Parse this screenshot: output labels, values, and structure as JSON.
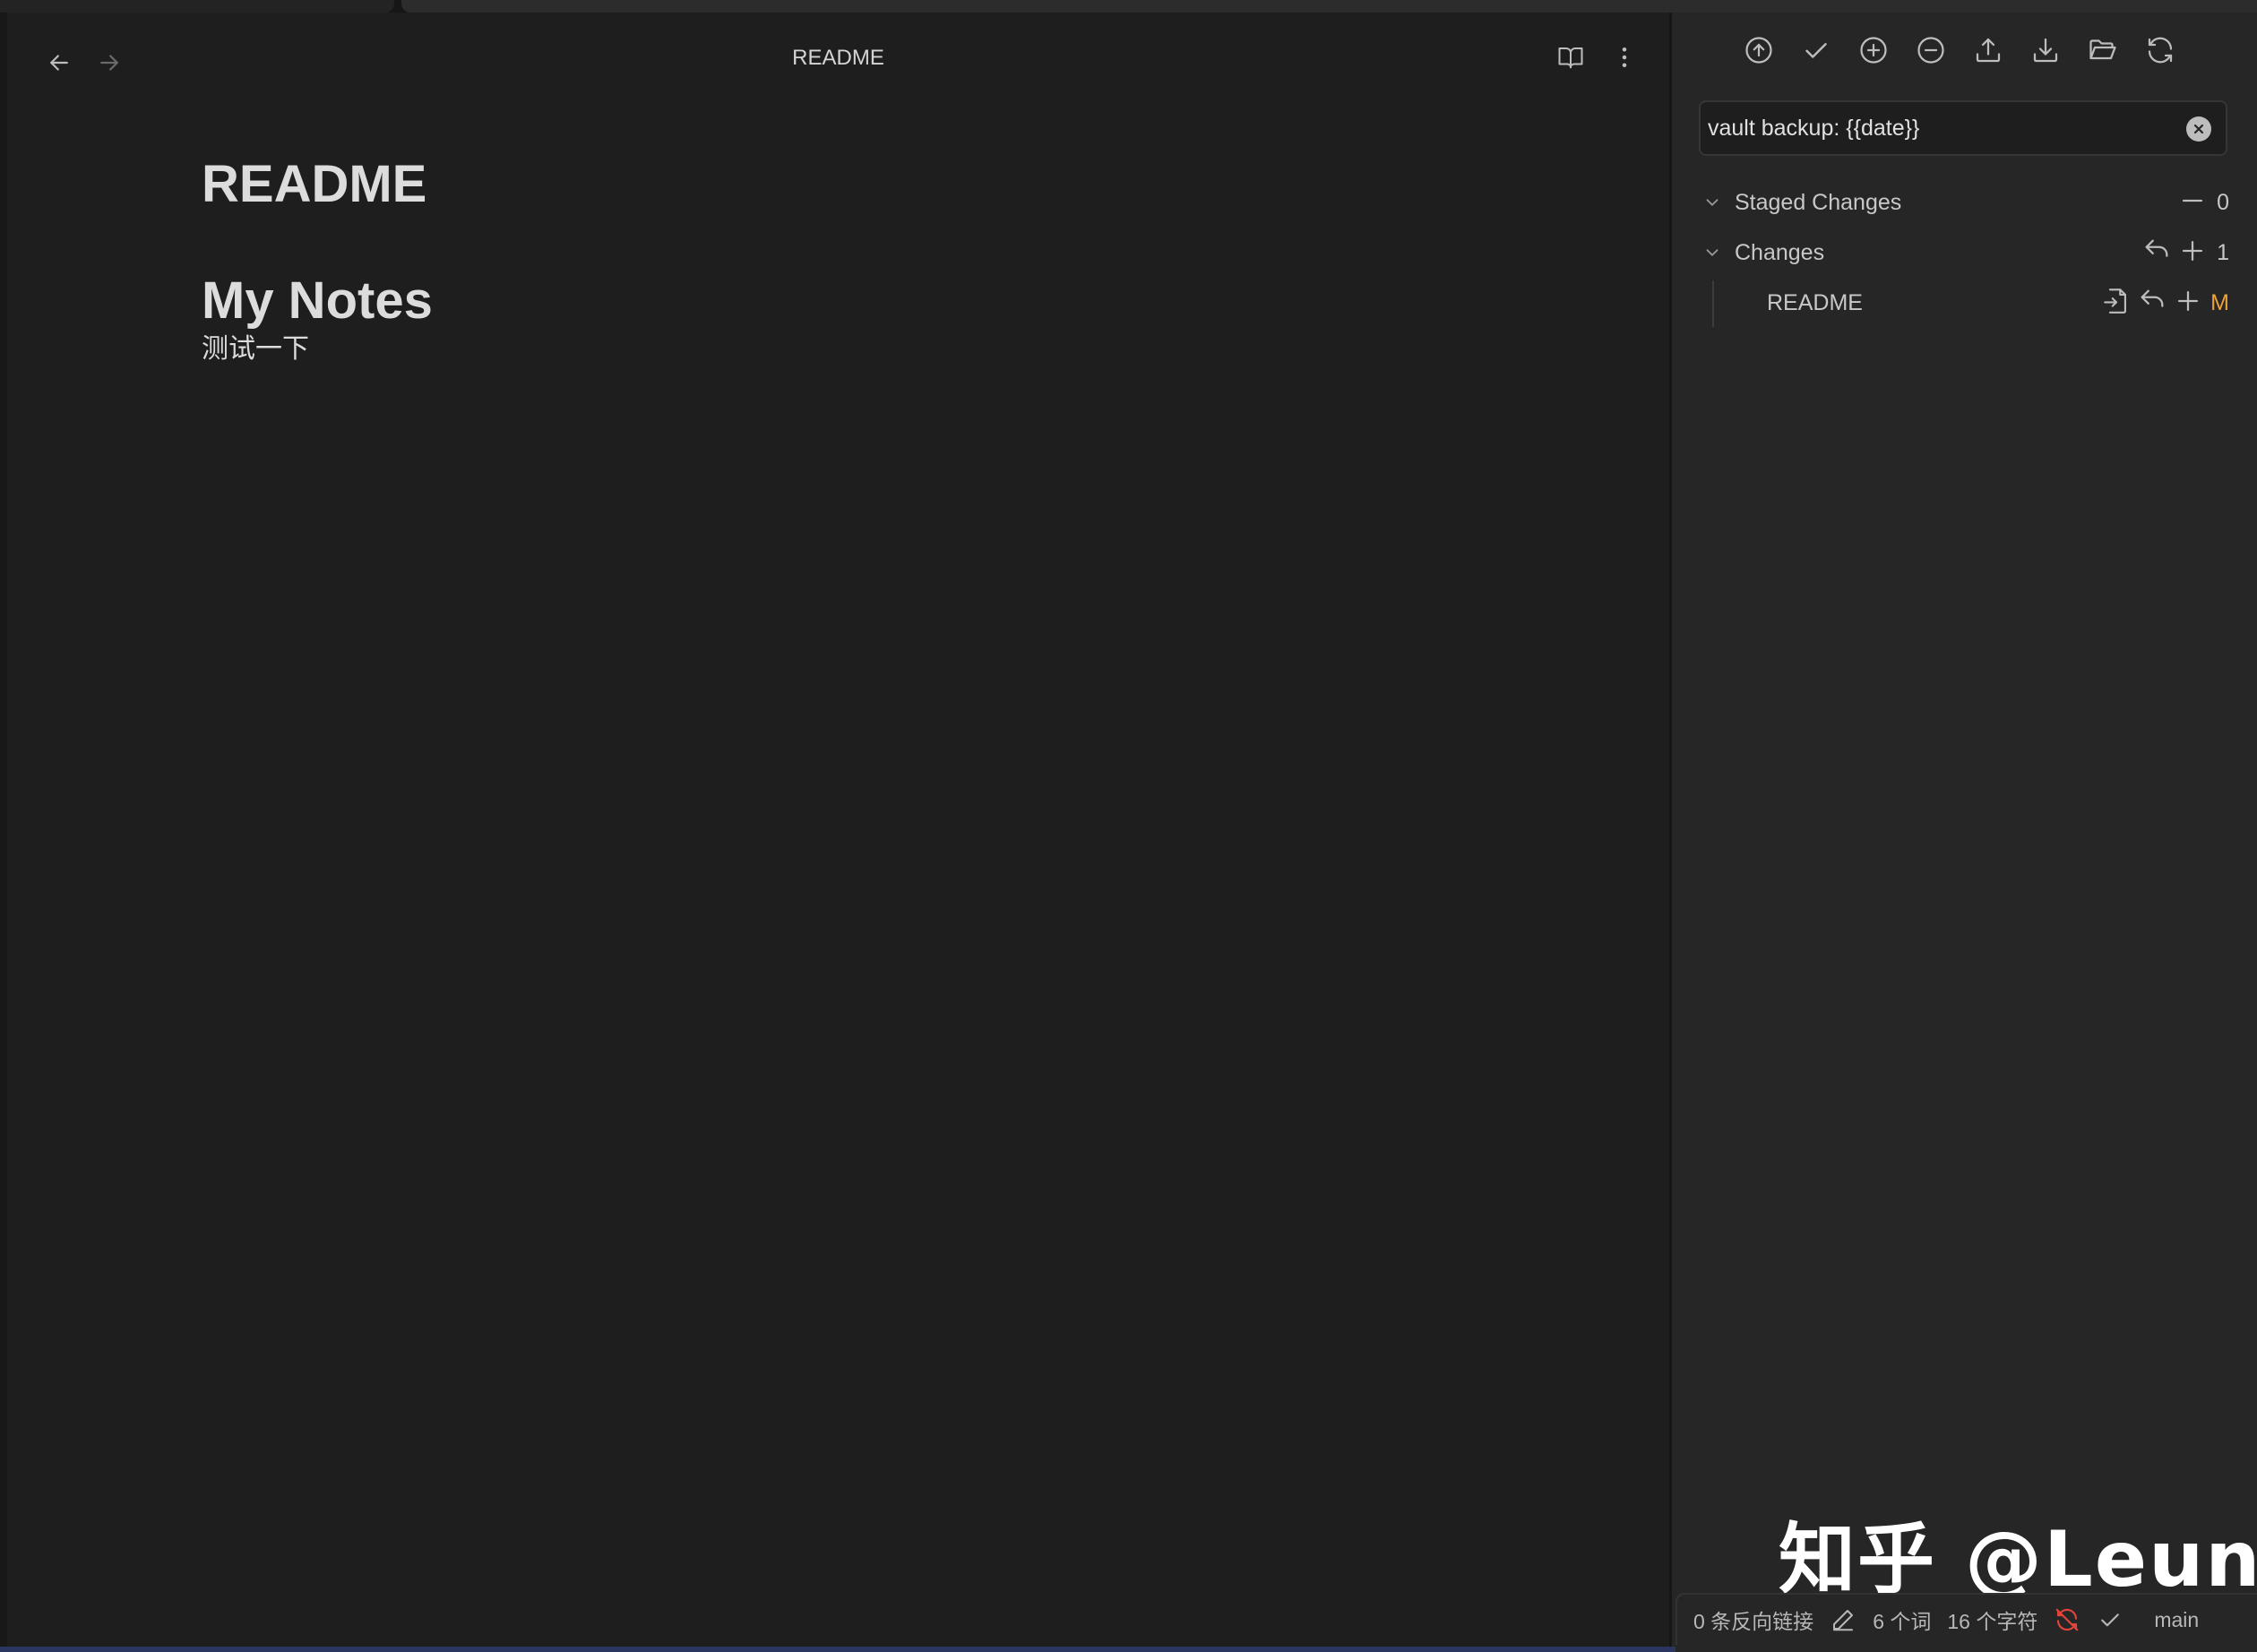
{
  "editor": {
    "view_title": "README",
    "doc_title": "README",
    "heading": "My Notes",
    "paragraph": "测试一下"
  },
  "git_panel": {
    "toolbar": [
      "push-icon",
      "commit-icon",
      "stage-all-icon",
      "unstage-all-icon",
      "upload-icon",
      "download-icon",
      "open-folder-icon",
      "refresh-icon"
    ],
    "commit_message": "vault backup: {{date}}",
    "staged": {
      "label": "Staged Changes",
      "count": "0"
    },
    "changes": {
      "label": "Changes",
      "count": "1"
    },
    "files": [
      {
        "name": "README",
        "status": "M"
      }
    ]
  },
  "statusbar": {
    "backlinks": "0 条反向链接",
    "words": "6 个词",
    "chars": "16 个字符",
    "branch": "main"
  },
  "watermark": "知乎 @Leung",
  "colors": {
    "background": "#1e1e1e",
    "sidebar": "#262626",
    "modified": "#e8a13c",
    "sync_error": "#e0443a"
  }
}
